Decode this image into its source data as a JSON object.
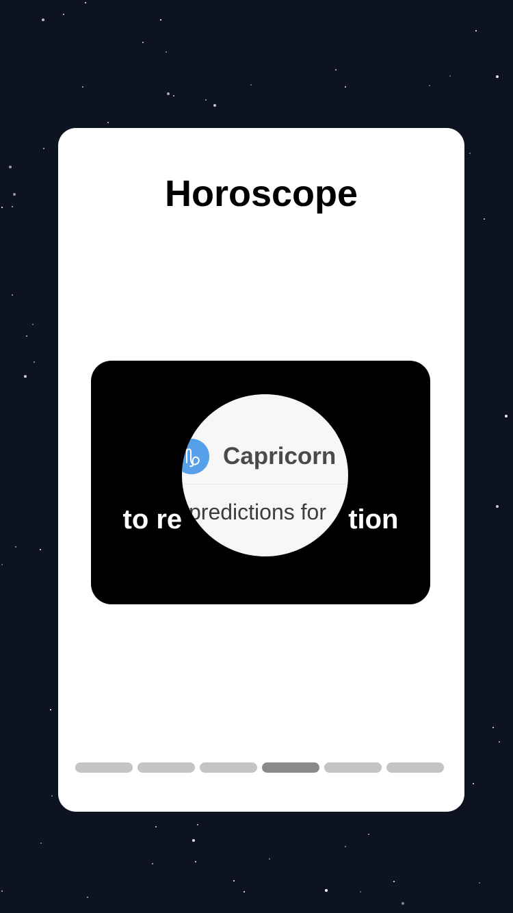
{
  "screen": {
    "background_color": "#0d1320",
    "star_color": "#ffffff"
  },
  "card": {
    "title": "Horoscope",
    "background_color": "#ffffff"
  },
  "tutorial": {
    "text_left": "to re",
    "text_right": "tion",
    "background_color": "#000000",
    "lens": {
      "sign_icon": "capricorn-icon",
      "sign_icon_color": "#55a0e8",
      "sign_name": "Capricorn",
      "subtitle": "predictions for"
    }
  },
  "pager": {
    "total_pages": 6,
    "active_page": 4,
    "active_color": "#8a8a8a",
    "inactive_color": "#c4c4c4"
  }
}
